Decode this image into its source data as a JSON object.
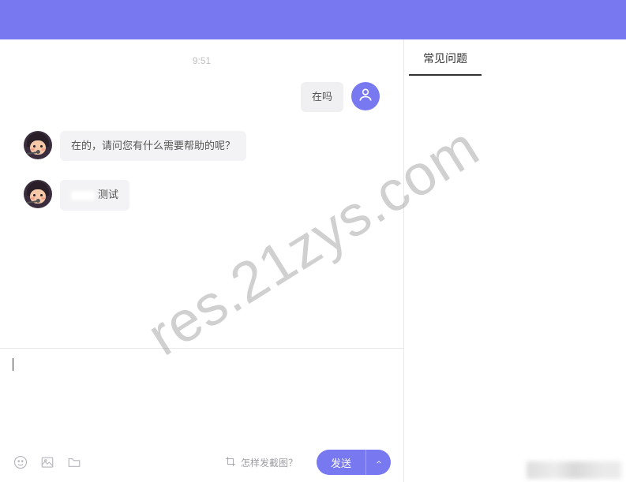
{
  "colors": {
    "primary": "#7879f1"
  },
  "timestamp": "9:51",
  "messages": {
    "m1": {
      "direction": "out",
      "text": "在吗"
    },
    "m2": {
      "direction": "in",
      "text": "在的，请问您有什么需要帮助的呢？"
    },
    "m3": {
      "direction": "in",
      "text": "测试"
    }
  },
  "toolbar": {
    "screenshot_hint": "怎样发截图？",
    "send_label": "发送"
  },
  "sidebar": {
    "faq_tab": "常见问题"
  },
  "watermark": "res.21zys.com"
}
